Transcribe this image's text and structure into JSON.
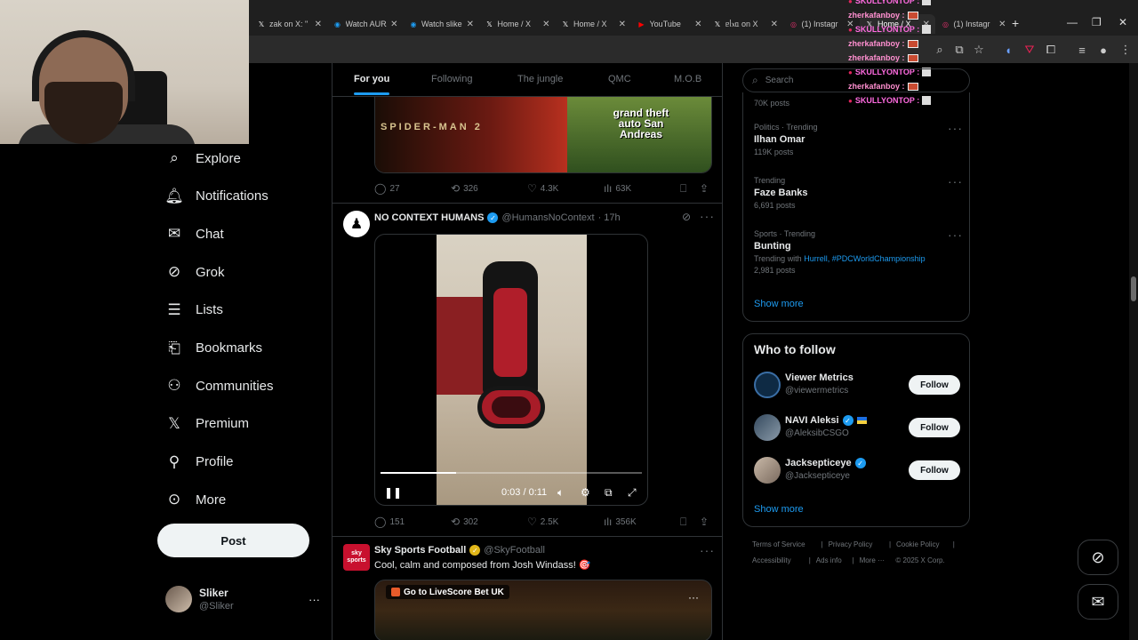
{
  "browser": {
    "tabs": [
      {
        "label": "zak on X: \"",
        "icon": "x-logo-icon",
        "color": "#ffffff"
      },
      {
        "label": "Watch AURA",
        "icon": "kick-icon",
        "color": "#1d9bf0"
      },
      {
        "label": "Watch slike",
        "icon": "kick-icon",
        "color": "#1d9bf0"
      },
      {
        "label": "Home / X",
        "icon": "x-logo-icon",
        "color": "#ffffff"
      },
      {
        "label": "Home / X",
        "icon": "x-logo-icon",
        "color": "#ffffff"
      },
      {
        "label": "YouTube",
        "icon": "youtube-icon",
        "color": "#ff0000"
      },
      {
        "label": "ᥱᥣ᥊ᥲ on X",
        "icon": "x-logo-icon",
        "color": "#ffffff"
      },
      {
        "label": "(1) Instagr",
        "icon": "instagram-icon",
        "color": "#e1306c"
      },
      {
        "label": "Home / X",
        "icon": "x-logo-icon",
        "color": "#ffffff"
      },
      {
        "label": "(1) Instagr",
        "icon": "instagram-icon",
        "color": "#e1306c"
      }
    ],
    "new_tab": "+"
  },
  "chat_overlay": [
    {
      "user": "SKULLYONTOP :",
      "type": "purp"
    },
    {
      "user": "zherkafanboy :",
      "type": "pink"
    },
    {
      "user": "SKULLYONTOP :",
      "type": "purp"
    },
    {
      "user": "zherkafanboy :",
      "type": "pink"
    },
    {
      "user": "zherkafanboy :",
      "type": "pink"
    },
    {
      "user": "SKULLYONTOP :",
      "type": "purp"
    },
    {
      "user": "zherkafanboy :",
      "type": "pink"
    },
    {
      "user": "SKULLYONTOP :",
      "type": "purp"
    }
  ],
  "nav": {
    "items": [
      {
        "label": "Explore",
        "icon": "search-icon"
      },
      {
        "label": "Notifications",
        "icon": "bell-icon"
      },
      {
        "label": "Chat",
        "icon": "mail-icon"
      },
      {
        "label": "Grok",
        "icon": "grok-icon"
      },
      {
        "label": "Lists",
        "icon": "list-icon"
      },
      {
        "label": "Bookmarks",
        "icon": "bookmark-icon"
      },
      {
        "label": "Communities",
        "icon": "people-icon"
      },
      {
        "label": "Premium",
        "icon": "x-logo-icon"
      },
      {
        "label": "Profile",
        "icon": "person-icon"
      },
      {
        "label": "More",
        "icon": "more-circle-icon"
      }
    ],
    "post_label": "Post",
    "account": {
      "name": "Sliker",
      "handle": "@Sliker"
    }
  },
  "feed": {
    "tabs": [
      "For you",
      "Following",
      "The jungle",
      "QMC",
      "M.O.B"
    ],
    "tweet1": {
      "media_left": "SPIDER-MAN 2",
      "media_right": "grand theft auto San Andreas",
      "replies": "27",
      "reposts": "326",
      "likes": "4.3K",
      "views": "63K"
    },
    "tweet2": {
      "name": "NO CONTEXT HUMANS",
      "handle": "@HumansNoContext",
      "time": "· 17h",
      "video_time": "0:03 / 0:11",
      "progress": 0.29,
      "replies": "151",
      "reposts": "302",
      "likes": "2.5K",
      "views": "356K"
    },
    "tweet3": {
      "name": "Sky Sports Football",
      "handle": "@SkyFootball",
      "text": "Cool, calm and composed from Josh Windass! 🎯",
      "avatar_text": "sky sports",
      "ad_label": "Go to LiveScore Bet UK"
    }
  },
  "sidebar": {
    "search_placeholder": "Search",
    "trends": [
      {
        "meta": "",
        "title": "",
        "sub": "70K posts"
      },
      {
        "meta": "Politics · Trending",
        "title": "Ilhan Omar",
        "sub": "119K posts"
      },
      {
        "meta": "Trending",
        "title": "Faze Banks",
        "sub": "6,691 posts"
      },
      {
        "meta": "Sports · Trending",
        "title": "Bunting",
        "with_prefix": "Trending with",
        "with_links": "Hurrell, #PDCWorldChampionship",
        "sub": "2,981 posts"
      }
    ],
    "show_more": "Show more",
    "who_to_follow": {
      "title": "Who to follow",
      "accounts": [
        {
          "name": "Viewer Metrics",
          "handle": "@viewermetrics",
          "verified": false
        },
        {
          "name": "NAVI Aleksi",
          "handle": "@AleksibCSGO",
          "verified": true
        },
        {
          "name": "Jacksepticeye",
          "handle": "@Jacksepticeye",
          "verified": true
        }
      ],
      "follow_label": "Follow",
      "show_more": "Show more"
    },
    "footer": [
      "Terms of Service",
      "|",
      "Privacy Policy",
      "|",
      "Cookie Policy",
      "|",
      "Accessibility",
      "|",
      "Ads info",
      "|",
      "More ···",
      "© 2025 X Corp."
    ]
  }
}
